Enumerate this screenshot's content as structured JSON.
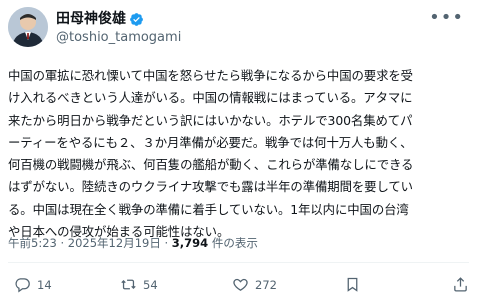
{
  "author": {
    "display_name": "田母神俊雄",
    "handle": "@toshio_tamogami",
    "verified_badge_color": "#1d9bf0"
  },
  "post": {
    "text": "中国の軍拡に恐れ慄いて中国を怒らせたら戦争になるから中国の要求を受\nけ入れるべきという人達がいる。中国の情報戦にはまっている。アタマに\n来たから明日から戦争だという訳にはいかない。ホテルで300名集めてパ\nーティーをやるにも２、３か月準備が必要だ。戦争では何十万人も動く、\n何百機の戦闘機が飛ぶ、何百隻の艦船が動く、これらが準備なしにできる\nはずがない。陸続きのウクライナ攻撃でも露は半年の準備期間を要してい\nる。中国は現在全く戦争の準備に着手していない。1年以内に中国の台湾\nや日本への侵攻が始まる可能性はない。",
    "timestamp": "午前5:23 · 2025年12月19日 · ",
    "views_count": "3,794",
    "views_suffix": " 件の表示"
  },
  "actions": {
    "reply_count": "14",
    "repost_count": "54",
    "like_count": "272"
  },
  "colors": {
    "text": "#0f1419",
    "secondary": "#536471",
    "divider": "#eff3f4"
  }
}
